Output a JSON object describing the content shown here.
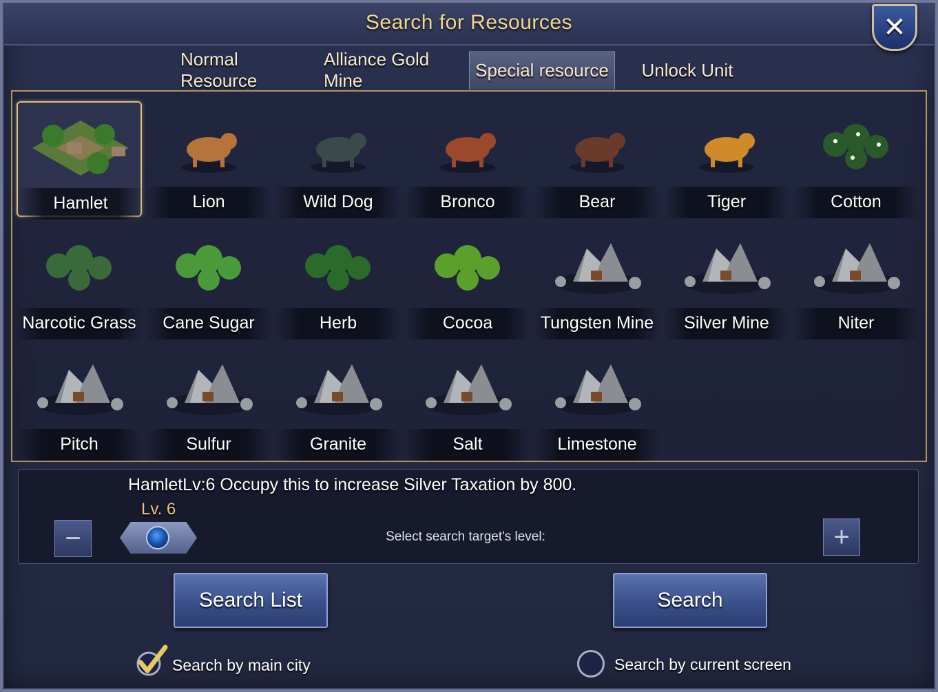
{
  "title": "Search for Resources",
  "tabs": [
    {
      "label": "Normal Resource",
      "active": false
    },
    {
      "label": "Alliance Gold Mine",
      "active": false
    },
    {
      "label": "Special resource",
      "active": true
    },
    {
      "label": "Unlock Unit",
      "active": false
    }
  ],
  "resources": [
    {
      "label": "Hamlet",
      "icon": "hamlet-icon",
      "selected": true
    },
    {
      "label": "Lion",
      "icon": "lion-icon"
    },
    {
      "label": "Wild Dog",
      "icon": "wild-dog-icon"
    },
    {
      "label": "Bronco",
      "icon": "bronco-icon"
    },
    {
      "label": "Bear",
      "icon": "bear-icon"
    },
    {
      "label": "Tiger",
      "icon": "tiger-icon"
    },
    {
      "label": "Cotton",
      "icon": "cotton-icon"
    },
    {
      "label": "Narcotic Grass",
      "icon": "narcotic-grass-icon"
    },
    {
      "label": "Cane Sugar",
      "icon": "cane-sugar-icon"
    },
    {
      "label": "Herb",
      "icon": "herb-icon"
    },
    {
      "label": "Cocoa",
      "icon": "cocoa-icon"
    },
    {
      "label": "Tungsten Mine",
      "icon": "tungsten-mine-icon"
    },
    {
      "label": "Silver Mine",
      "icon": "silver-mine-icon"
    },
    {
      "label": "Niter",
      "icon": "niter-icon"
    },
    {
      "label": "Pitch",
      "icon": "pitch-icon"
    },
    {
      "label": "Sulfur",
      "icon": "sulfur-icon"
    },
    {
      "label": "Granite",
      "icon": "granite-icon"
    },
    {
      "label": "Salt",
      "icon": "salt-icon"
    },
    {
      "label": "Limestone",
      "icon": "limestone-icon"
    }
  ],
  "info": {
    "description": "HamletLv:6 Occupy this to increase Silver Taxation by 800.",
    "level_label": "Lv. 6",
    "level": 6,
    "slider_hint": "Select search target's level:"
  },
  "buttons": {
    "search_list": "Search List",
    "search": "Search"
  },
  "options": {
    "main_city": {
      "label": "Search by main city",
      "checked": true
    },
    "current_screen": {
      "label": "Search by current screen",
      "checked": false
    }
  },
  "colors": {
    "title_gold": "#f2d68b",
    "level_orange": "#f2c27a",
    "selection_border": "#d8c17f",
    "button_blue": "#3a4f8a"
  }
}
